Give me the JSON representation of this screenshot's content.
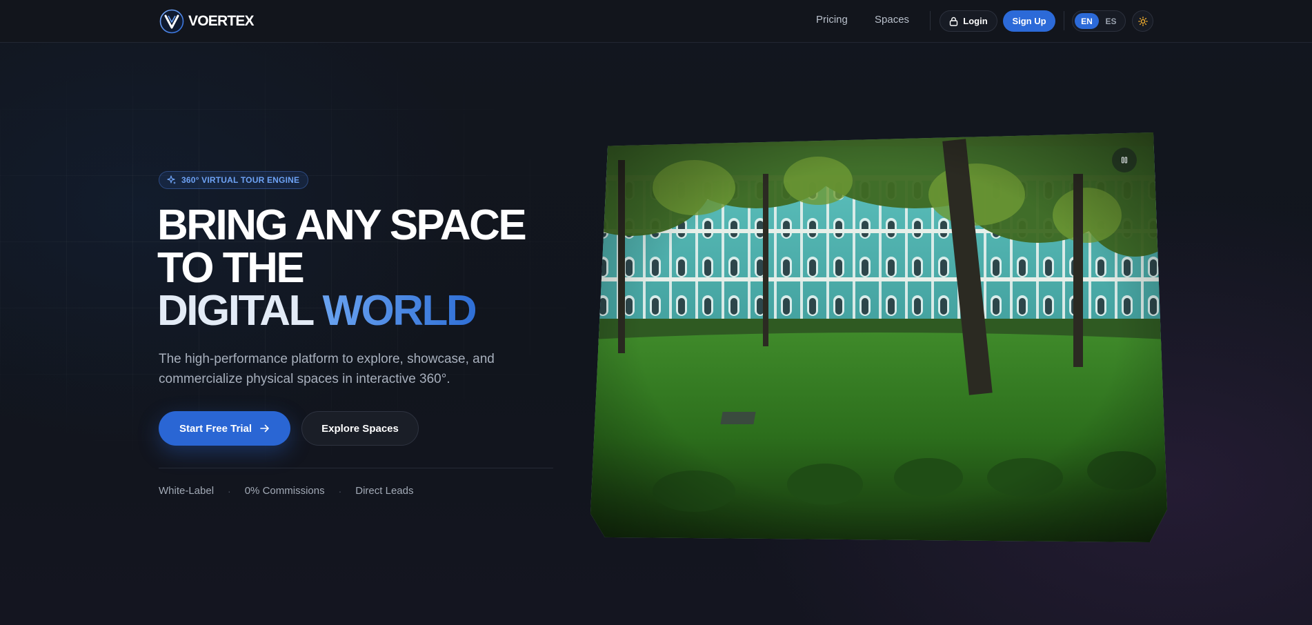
{
  "nav": {
    "brand": "VOERTEX",
    "links": [
      {
        "label": "Pricing"
      },
      {
        "label": "Spaces"
      }
    ],
    "login_label": "Login",
    "signup_label": "Sign Up",
    "languages": [
      "EN",
      "ES"
    ],
    "active_language": "EN"
  },
  "hero": {
    "badge": "360° VIRTUAL TOUR ENGINE",
    "headline_line1": "BRING ANY SPACE",
    "headline_line2": "TO THE",
    "headline_line3a": "DIGITAL",
    "headline_line3b": "WORLD",
    "subtitle": "The high-performance platform to explore, showcase, and commercialize physical spaces in interactive 360°.",
    "primary_cta": "Start Free Trial",
    "secondary_cta": "Explore Spaces",
    "features": [
      "White-Label",
      "0% Commissions",
      "Direct Leads"
    ]
  },
  "icons": {
    "logo": "v-logo-icon",
    "login": "lock-icon",
    "theme": "sun-icon",
    "badge": "sparkles-icon",
    "cta": "arrow-right-icon",
    "viewer": "pause-icon"
  },
  "colors": {
    "accent": "#2c6ad8",
    "accent_light": "#6ea3f5",
    "background": "#11151d"
  }
}
